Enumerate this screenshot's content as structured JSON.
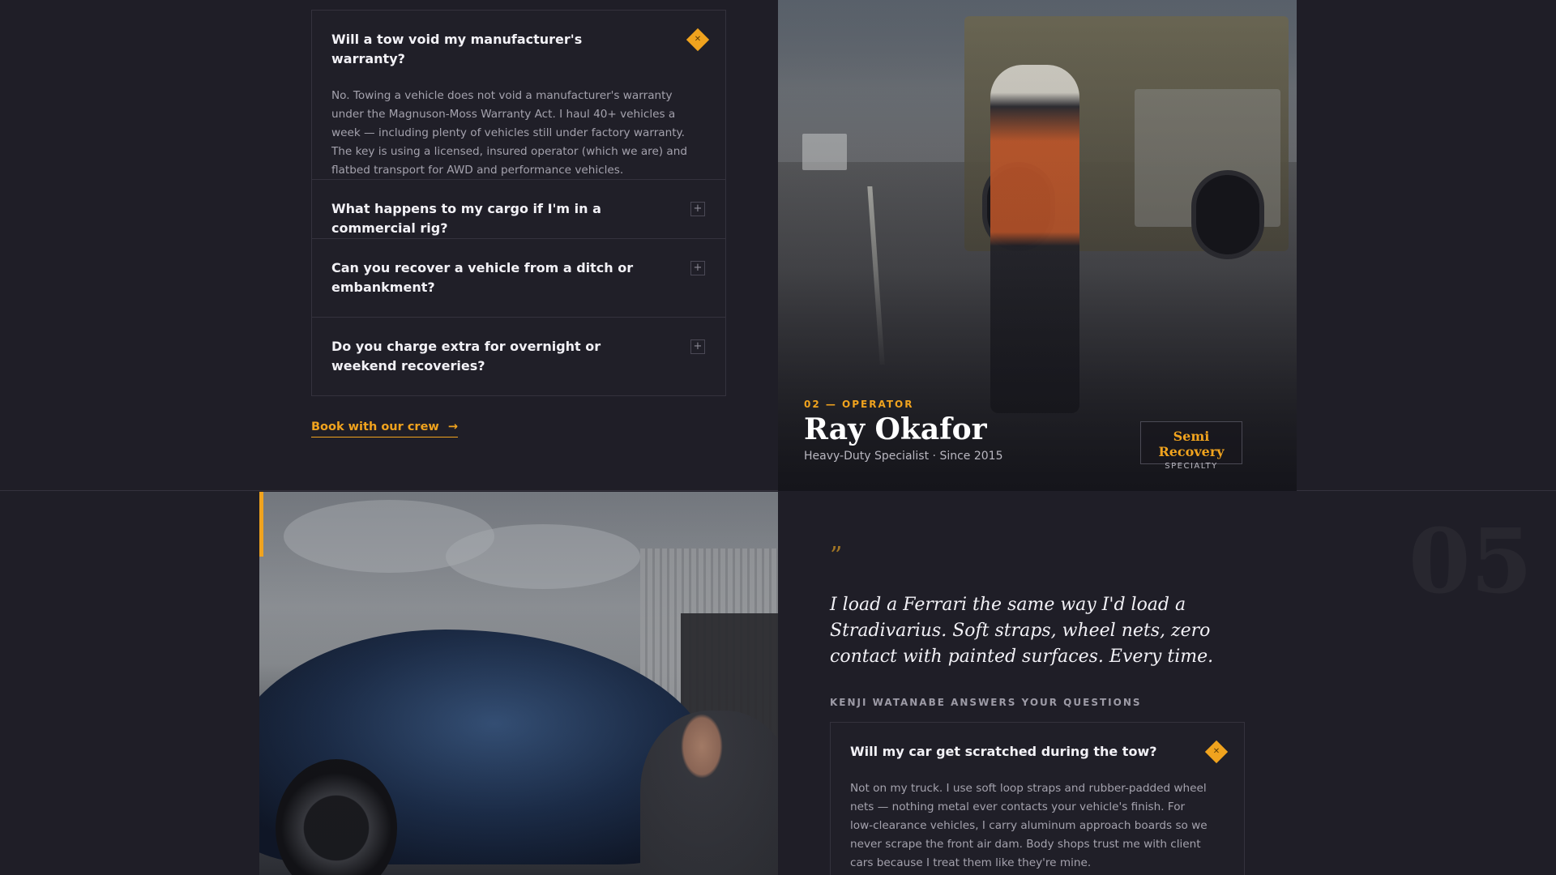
{
  "faq_top": {
    "open_item": {
      "question": "Will a tow void my manufacturer's warranty?",
      "answer": "No. Towing a vehicle does not void a manufacturer's warranty under the Magnuson-Moss Warranty Act. I haul 40+ vehicles a week — including plenty of vehicles still under factory warranty. The key is using a licensed, insured operator (which we are) and flatbed transport for AWD and performance vehicles.",
      "icon": "close-icon"
    },
    "items": [
      {
        "question": "What happens to my cargo if I'm in a commercial rig?",
        "icon": "plus-icon"
      },
      {
        "question": "Can you recover a vehicle from a ditch or embankment?",
        "icon": "plus-icon"
      },
      {
        "question": "Do you charge extra for overnight or weekend recoveries?",
        "icon": "plus-icon"
      }
    ],
    "cta": "Book with our crew",
    "cta_icon": "arrow-right-icon"
  },
  "operator": {
    "kicker": "02 — OPERATOR",
    "name": "Ray Okafor",
    "subtitle": "Heavy-Duty Specialist · Since 2015",
    "badge_title": "Semi Recovery",
    "badge_sub": "SPECIALTY"
  },
  "testimonial": {
    "quote_mark": "”",
    "quote": "I load a Ferrari the same way I'd load a Stradivarius. Soft straps, wheel nets, zero contact with painted surfaces. Every time.",
    "section_label": "KENJI WATANABE ANSWERS YOUR QUESTIONS",
    "number": "05"
  },
  "faq_bottom": {
    "open_item": {
      "question": "Will my car get scratched during the tow?",
      "answer": "Not on my truck. I use soft loop straps and rubber-padded wheel nets — nothing metal ever contacts your vehicle's finish. For low-clearance vehicles, I carry aluminum approach boards so we never scrape the front air dam. Body shops trust me with client cars because I treat them like they're mine.",
      "icon": "close-icon"
    }
  },
  "colors": {
    "accent": "#f0a31e",
    "background": "#1f1e27",
    "border": "#34323d"
  }
}
